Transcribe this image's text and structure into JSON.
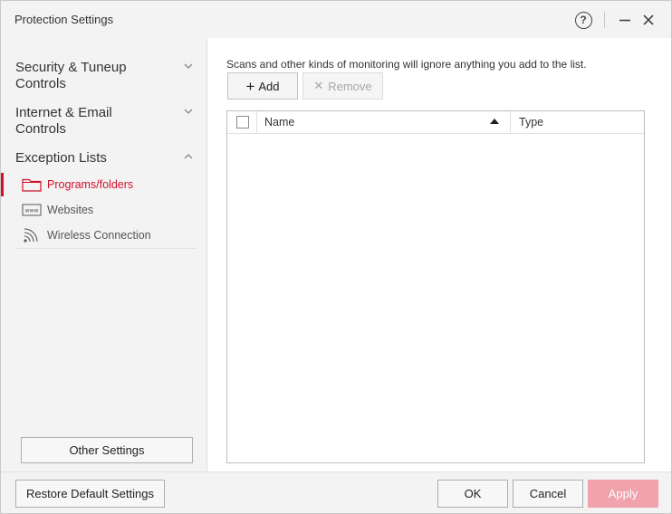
{
  "window": {
    "title": "Protection Settings",
    "help_glyph": "?"
  },
  "sidebar": {
    "categories": [
      {
        "label": "Security & Tuneup Controls",
        "icon": "chevron-down-icon"
      },
      {
        "label": "Internet & Email Controls",
        "icon": "chevron-down-icon"
      },
      {
        "label": "Exception Lists",
        "icon": "chevron-up-icon"
      }
    ],
    "subitems": [
      {
        "label": "Programs/folders",
        "icon": "folder-icon",
        "active": true
      },
      {
        "label": "Websites",
        "icon": "www-icon",
        "active": false
      },
      {
        "label": "Wireless Connection",
        "icon": "wifi-icon",
        "active": false
      }
    ],
    "other_settings_label": "Other Settings"
  },
  "content": {
    "description": "Scans and other kinds of monitoring will ignore anything you add to the list.",
    "add_label": "Add",
    "remove_label": "Remove",
    "table": {
      "columns": [
        "Name",
        "Type"
      ],
      "sort_column": "Name",
      "rows": []
    }
  },
  "footer": {
    "restore_label": "Restore Default Settings",
    "ok_label": "OK",
    "cancel_label": "Cancel",
    "apply_label": "Apply"
  },
  "colors": {
    "accent": "#d0112b",
    "apply_disabled_bg": "#f0a2ad"
  }
}
